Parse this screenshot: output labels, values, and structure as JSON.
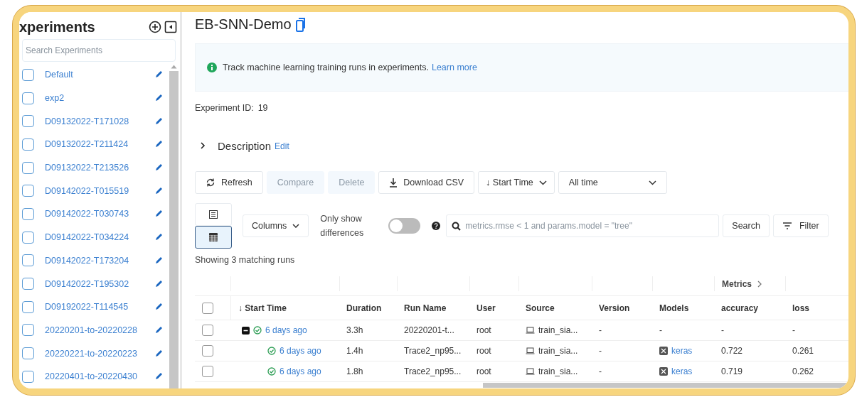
{
  "sidebar": {
    "title": "xperiments",
    "search": {
      "placeholder": "Search Experiments"
    },
    "items": [
      {
        "name": "Default",
        "checked": false
      },
      {
        "name": "exp2",
        "checked": false
      },
      {
        "name": "D09132022-T171028",
        "checked": false
      },
      {
        "name": "D09132022-T211424",
        "checked": false
      },
      {
        "name": "D09132022-T213526",
        "checked": false
      },
      {
        "name": "D09142022-T015519",
        "checked": false
      },
      {
        "name": "D09142022-T030743",
        "checked": false
      },
      {
        "name": "D09142022-T034224",
        "checked": false
      },
      {
        "name": "D09142022-T173204",
        "checked": false
      },
      {
        "name": "D09142022-T195302",
        "checked": false
      },
      {
        "name": "D09192022-T114545",
        "checked": false
      },
      {
        "name": "20220201-to-20220228",
        "checked": false
      },
      {
        "name": "20220221-to-20220223",
        "checked": false
      },
      {
        "name": "20220401-to-20220430",
        "checked": false
      }
    ]
  },
  "header": {
    "title": "EB-SNN-Demo"
  },
  "banner": {
    "text": "Track machine learning training runs in experiments.",
    "link": "Learn more"
  },
  "experiment_id": {
    "label": "Experiment ID:",
    "value": "19"
  },
  "description": {
    "label": "Description",
    "edit": "Edit",
    "expanded": false
  },
  "toolbar": [
    {
      "kind": "refresh",
      "label": "Refresh",
      "disabled": false
    },
    {
      "kind": "plain",
      "label": "Compare",
      "disabled": true
    },
    {
      "kind": "plain",
      "label": "Delete",
      "disabled": true
    },
    {
      "kind": "download",
      "label": "Download CSV",
      "disabled": false
    },
    {
      "kind": "sort",
      "label": "↓ Start Time",
      "disabled": false
    },
    {
      "kind": "select",
      "label": "All time",
      "disabled": false
    }
  ],
  "views": [
    {
      "kind": "list",
      "selected": false
    },
    {
      "kind": "table",
      "selected": true
    }
  ],
  "columns_button": "Columns",
  "diff_toggle": {
    "label": "Only show differences",
    "on": false
  },
  "search": {
    "placeholder": "metrics.rmse < 1 and params.model = \"tree\"",
    "button": "Search",
    "filter": "Filter"
  },
  "count": "Showing 3 matching runs",
  "table": {
    "group_header": "Metrics",
    "header_checked": false,
    "columns": [
      "↓ Start Time",
      "Duration",
      "Run Name",
      "User",
      "Source",
      "Version",
      "Models",
      "accuracy",
      "loss"
    ],
    "rows": [
      {
        "checked": false,
        "expanded": true,
        "start_time": "6 days ago",
        "duration": "3.3h",
        "run_name": "20220201-t...",
        "user": "root",
        "source": "train_sia...",
        "version": "-",
        "model": "-",
        "accuracy": "-",
        "loss": "-",
        "children": [
          {
            "checked": false,
            "start_time": "6 days ago",
            "duration": "1.4h",
            "run_name": "Trace2_np95...",
            "user": "root",
            "source": "train_sia...",
            "version": "-",
            "model": "keras",
            "accuracy": "0.722",
            "loss": "0.261"
          },
          {
            "checked": false,
            "start_time": "6 days ago",
            "duration": "1.8h",
            "run_name": "Trace2_np95...",
            "user": "root",
            "source": "train_sia...",
            "version": "-",
            "model": "keras",
            "accuracy": "0.719",
            "loss": "0.262"
          }
        ]
      }
    ]
  }
}
